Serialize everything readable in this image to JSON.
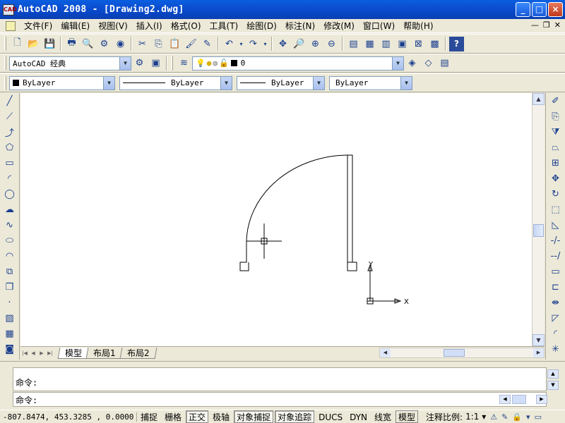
{
  "window": {
    "title": "AutoCAD 2008 - [Drawing2.dwg]",
    "app_icon_text": "CAD",
    "minimize": "_",
    "maximize": "□",
    "close": "×"
  },
  "menu": {
    "items": [
      "文件(F)",
      "编辑(E)",
      "视图(V)",
      "插入(I)",
      "格式(O)",
      "工具(T)",
      "绘图(D)",
      "标注(N)",
      "修改(M)",
      "窗口(W)",
      "帮助(H)"
    ],
    "mdi_minimize": "—",
    "mdi_restore": "❐",
    "mdi_close": "✕"
  },
  "toolbar2": {
    "workspace": "AutoCAD 经典",
    "layer": "0"
  },
  "toolbar3": {
    "color": "ByLayer",
    "linetype": "ByLayer",
    "lineweight": "ByLayer",
    "plotstyle": "ByLayer"
  },
  "drawing": {
    "ucs_y_label": "Y",
    "ucs_x_label": "X"
  },
  "tabs": {
    "items": [
      "模型",
      "布局1",
      "布局2"
    ],
    "active": "模型"
  },
  "command": {
    "history_line": "命令:",
    "prompt": "命令:"
  },
  "status": {
    "coordinates": "-807.8474, 453.3285 , 0.0000",
    "snap": "捕捉",
    "grid": "栅格",
    "ortho": "正交",
    "polar": "极轴",
    "osnap": "对象捕捉",
    "otrack": "对象追踪",
    "ducs": "DUCS",
    "dyn": "DYN",
    "lwt": "线宽",
    "model": "模型",
    "annotation_scale_label": "注释比例:",
    "annotation_scale_value": "1:1 ▾"
  },
  "icons": {
    "colors": {
      "toolbar_blue": "#1a3f8f",
      "title_blue": "#0846c4",
      "close_red": "#c0381a"
    }
  }
}
